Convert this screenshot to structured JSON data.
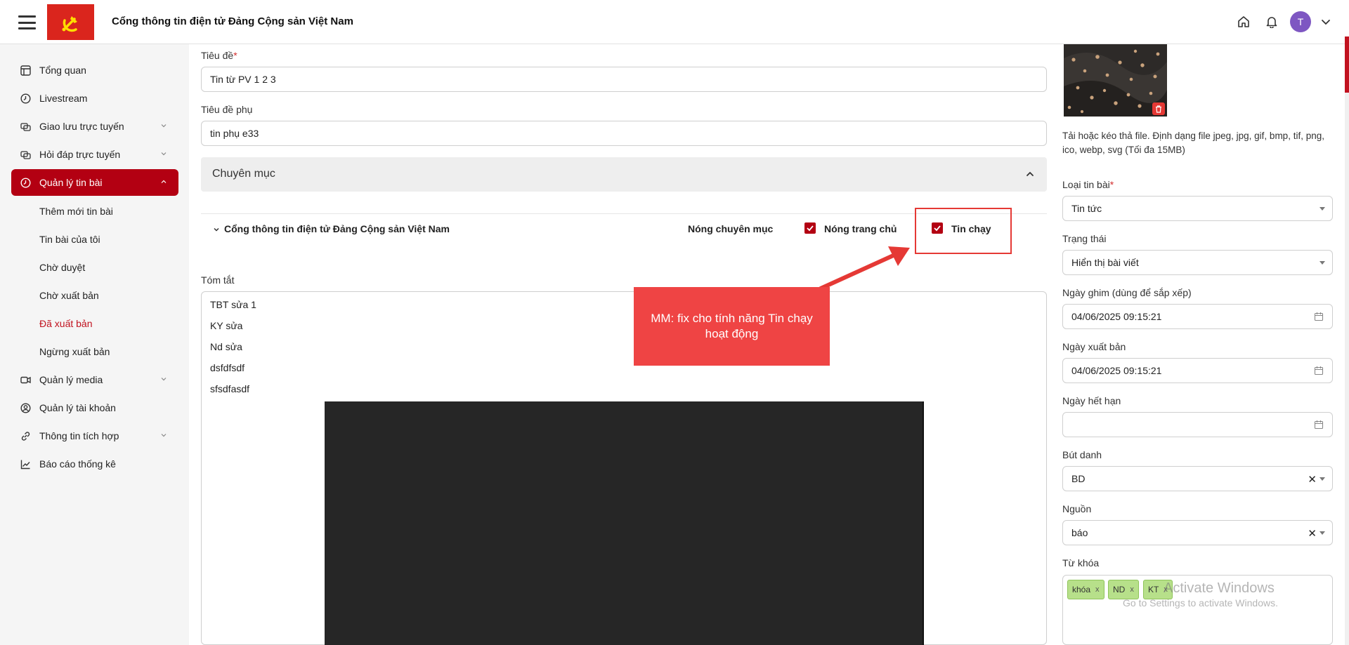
{
  "header": {
    "site_title": "Cổng thông tin điện tử Đảng Cộng sản Việt Nam",
    "avatar_initial": "T"
  },
  "sidebar": {
    "items": [
      {
        "label": "Tổng quan",
        "icon": "dashboard-icon"
      },
      {
        "label": "Livestream",
        "icon": "clock-icon"
      },
      {
        "label": "Giao lưu trực tuyến",
        "icon": "chat-icon",
        "expandable": true
      },
      {
        "label": "Hỏi đáp trực tuyến",
        "icon": "chat-icon",
        "expandable": true
      },
      {
        "label": "Quản lý tin bài",
        "icon": "clock-icon",
        "expandable": true,
        "active": true
      },
      {
        "label": "Quản lý media",
        "icon": "video-icon",
        "expandable": true
      },
      {
        "label": "Quản lý tài khoản",
        "icon": "user-icon"
      },
      {
        "label": "Thông tin tích hợp",
        "icon": "link-icon",
        "expandable": true
      },
      {
        "label": "Báo cáo thống kê",
        "icon": "chart-icon"
      }
    ],
    "sub_items": [
      {
        "label": "Thêm mới tin bài"
      },
      {
        "label": "Tin bài của tôi"
      },
      {
        "label": "Chờ duyệt"
      },
      {
        "label": "Chờ xuất bản"
      },
      {
        "label": "Đã xuất bản",
        "active": true
      },
      {
        "label": "Ngừng xuất bản"
      }
    ]
  },
  "form": {
    "title_label": "Tiêu đề",
    "title_required": "*",
    "title_value": "Tin từ PV 1 2 3",
    "subtitle_label": "Tiêu đề phụ",
    "subtitle_value": "tin phụ e33",
    "section_title": "Chuyên mục",
    "category_name": "Cổng thông tin điện tử Đảng Cộng sản Việt Nam",
    "check_labels": {
      "hot_category": "Nóng chuyên mục",
      "hot_home": "Nóng trang chủ",
      "running": "Tin chạy"
    },
    "summary_label": "Tóm tắt",
    "summary_lines": [
      "TBT sửa 1",
      "KY sửa",
      "Nd sửa",
      "dsfdfsdf",
      "sfsdfasdf"
    ]
  },
  "annotation": {
    "callout_text": "MM: fix cho tính năng Tin chạy hoạt động",
    "color": "#ef4444"
  },
  "right_panel": {
    "upload_hint": "Tải hoặc kéo thả file. Định dạng file jpeg, jpg, gif, bmp, tif, png, ico, webp, svg (Tối đa 15MB)",
    "article_type_label": "Loại tin bài",
    "article_type_required": "*",
    "article_type_value": "Tin tức",
    "status_label": "Trạng thái",
    "status_value": "Hiển thị bài viết",
    "pin_date_label": "Ngày ghim (dùng để sắp xếp)",
    "pin_date_value": "04/06/2025 09:15:21",
    "publish_date_label": "Ngày xuất bản",
    "publish_date_value": "04/06/2025 09:15:21",
    "expire_date_label": "Ngày hết hạn",
    "expire_date_value": "",
    "pen_name_label": "Bút danh",
    "pen_name_value": "BD",
    "source_label": "Nguồn",
    "source_value": "báo",
    "keywords_label": "Từ khóa",
    "keywords": [
      "khóa",
      "ND",
      "KT"
    ],
    "tag_remove": "x",
    "clear_symbol": "✕"
  },
  "watermark": {
    "line1": "Activate Windows",
    "line2": "Go to Settings to activate Windows."
  },
  "colors": {
    "brand_red": "#b30012",
    "flag_red": "#da251d",
    "avatar": "#7e57c2",
    "tag_green": "#b7e08a"
  }
}
